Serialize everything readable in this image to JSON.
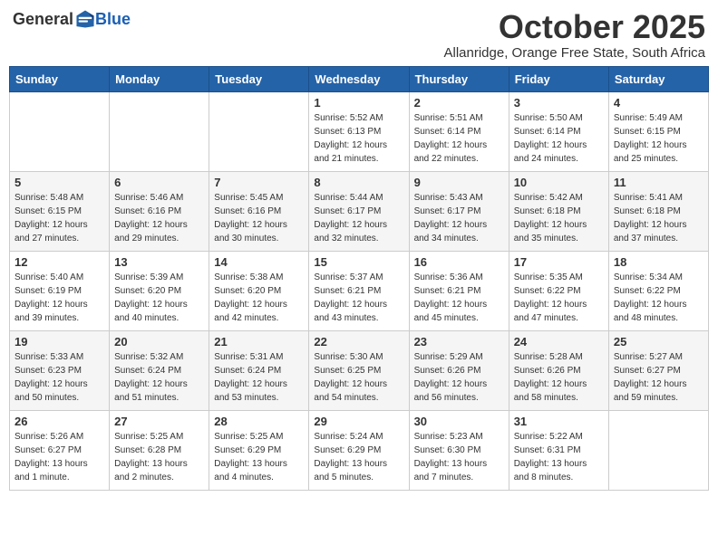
{
  "header": {
    "logo_general": "General",
    "logo_blue": "Blue",
    "month_title": "October 2025",
    "subtitle": "Allanridge, Orange Free State, South Africa"
  },
  "weekdays": [
    "Sunday",
    "Monday",
    "Tuesday",
    "Wednesday",
    "Thursday",
    "Friday",
    "Saturday"
  ],
  "weeks": [
    [
      {
        "day": "",
        "info": ""
      },
      {
        "day": "",
        "info": ""
      },
      {
        "day": "",
        "info": ""
      },
      {
        "day": "1",
        "info": "Sunrise: 5:52 AM\nSunset: 6:13 PM\nDaylight: 12 hours\nand 21 minutes."
      },
      {
        "day": "2",
        "info": "Sunrise: 5:51 AM\nSunset: 6:14 PM\nDaylight: 12 hours\nand 22 minutes."
      },
      {
        "day": "3",
        "info": "Sunrise: 5:50 AM\nSunset: 6:14 PM\nDaylight: 12 hours\nand 24 minutes."
      },
      {
        "day": "4",
        "info": "Sunrise: 5:49 AM\nSunset: 6:15 PM\nDaylight: 12 hours\nand 25 minutes."
      }
    ],
    [
      {
        "day": "5",
        "info": "Sunrise: 5:48 AM\nSunset: 6:15 PM\nDaylight: 12 hours\nand 27 minutes."
      },
      {
        "day": "6",
        "info": "Sunrise: 5:46 AM\nSunset: 6:16 PM\nDaylight: 12 hours\nand 29 minutes."
      },
      {
        "day": "7",
        "info": "Sunrise: 5:45 AM\nSunset: 6:16 PM\nDaylight: 12 hours\nand 30 minutes."
      },
      {
        "day": "8",
        "info": "Sunrise: 5:44 AM\nSunset: 6:17 PM\nDaylight: 12 hours\nand 32 minutes."
      },
      {
        "day": "9",
        "info": "Sunrise: 5:43 AM\nSunset: 6:17 PM\nDaylight: 12 hours\nand 34 minutes."
      },
      {
        "day": "10",
        "info": "Sunrise: 5:42 AM\nSunset: 6:18 PM\nDaylight: 12 hours\nand 35 minutes."
      },
      {
        "day": "11",
        "info": "Sunrise: 5:41 AM\nSunset: 6:18 PM\nDaylight: 12 hours\nand 37 minutes."
      }
    ],
    [
      {
        "day": "12",
        "info": "Sunrise: 5:40 AM\nSunset: 6:19 PM\nDaylight: 12 hours\nand 39 minutes."
      },
      {
        "day": "13",
        "info": "Sunrise: 5:39 AM\nSunset: 6:20 PM\nDaylight: 12 hours\nand 40 minutes."
      },
      {
        "day": "14",
        "info": "Sunrise: 5:38 AM\nSunset: 6:20 PM\nDaylight: 12 hours\nand 42 minutes."
      },
      {
        "day": "15",
        "info": "Sunrise: 5:37 AM\nSunset: 6:21 PM\nDaylight: 12 hours\nand 43 minutes."
      },
      {
        "day": "16",
        "info": "Sunrise: 5:36 AM\nSunset: 6:21 PM\nDaylight: 12 hours\nand 45 minutes."
      },
      {
        "day": "17",
        "info": "Sunrise: 5:35 AM\nSunset: 6:22 PM\nDaylight: 12 hours\nand 47 minutes."
      },
      {
        "day": "18",
        "info": "Sunrise: 5:34 AM\nSunset: 6:22 PM\nDaylight: 12 hours\nand 48 minutes."
      }
    ],
    [
      {
        "day": "19",
        "info": "Sunrise: 5:33 AM\nSunset: 6:23 PM\nDaylight: 12 hours\nand 50 minutes."
      },
      {
        "day": "20",
        "info": "Sunrise: 5:32 AM\nSunset: 6:24 PM\nDaylight: 12 hours\nand 51 minutes."
      },
      {
        "day": "21",
        "info": "Sunrise: 5:31 AM\nSunset: 6:24 PM\nDaylight: 12 hours\nand 53 minutes."
      },
      {
        "day": "22",
        "info": "Sunrise: 5:30 AM\nSunset: 6:25 PM\nDaylight: 12 hours\nand 54 minutes."
      },
      {
        "day": "23",
        "info": "Sunrise: 5:29 AM\nSunset: 6:26 PM\nDaylight: 12 hours\nand 56 minutes."
      },
      {
        "day": "24",
        "info": "Sunrise: 5:28 AM\nSunset: 6:26 PM\nDaylight: 12 hours\nand 58 minutes."
      },
      {
        "day": "25",
        "info": "Sunrise: 5:27 AM\nSunset: 6:27 PM\nDaylight: 12 hours\nand 59 minutes."
      }
    ],
    [
      {
        "day": "26",
        "info": "Sunrise: 5:26 AM\nSunset: 6:27 PM\nDaylight: 13 hours\nand 1 minute."
      },
      {
        "day": "27",
        "info": "Sunrise: 5:25 AM\nSunset: 6:28 PM\nDaylight: 13 hours\nand 2 minutes."
      },
      {
        "day": "28",
        "info": "Sunrise: 5:25 AM\nSunset: 6:29 PM\nDaylight: 13 hours\nand 4 minutes."
      },
      {
        "day": "29",
        "info": "Sunrise: 5:24 AM\nSunset: 6:29 PM\nDaylight: 13 hours\nand 5 minutes."
      },
      {
        "day": "30",
        "info": "Sunrise: 5:23 AM\nSunset: 6:30 PM\nDaylight: 13 hours\nand 7 minutes."
      },
      {
        "day": "31",
        "info": "Sunrise: 5:22 AM\nSunset: 6:31 PM\nDaylight: 13 hours\nand 8 minutes."
      },
      {
        "day": "",
        "info": ""
      }
    ]
  ]
}
